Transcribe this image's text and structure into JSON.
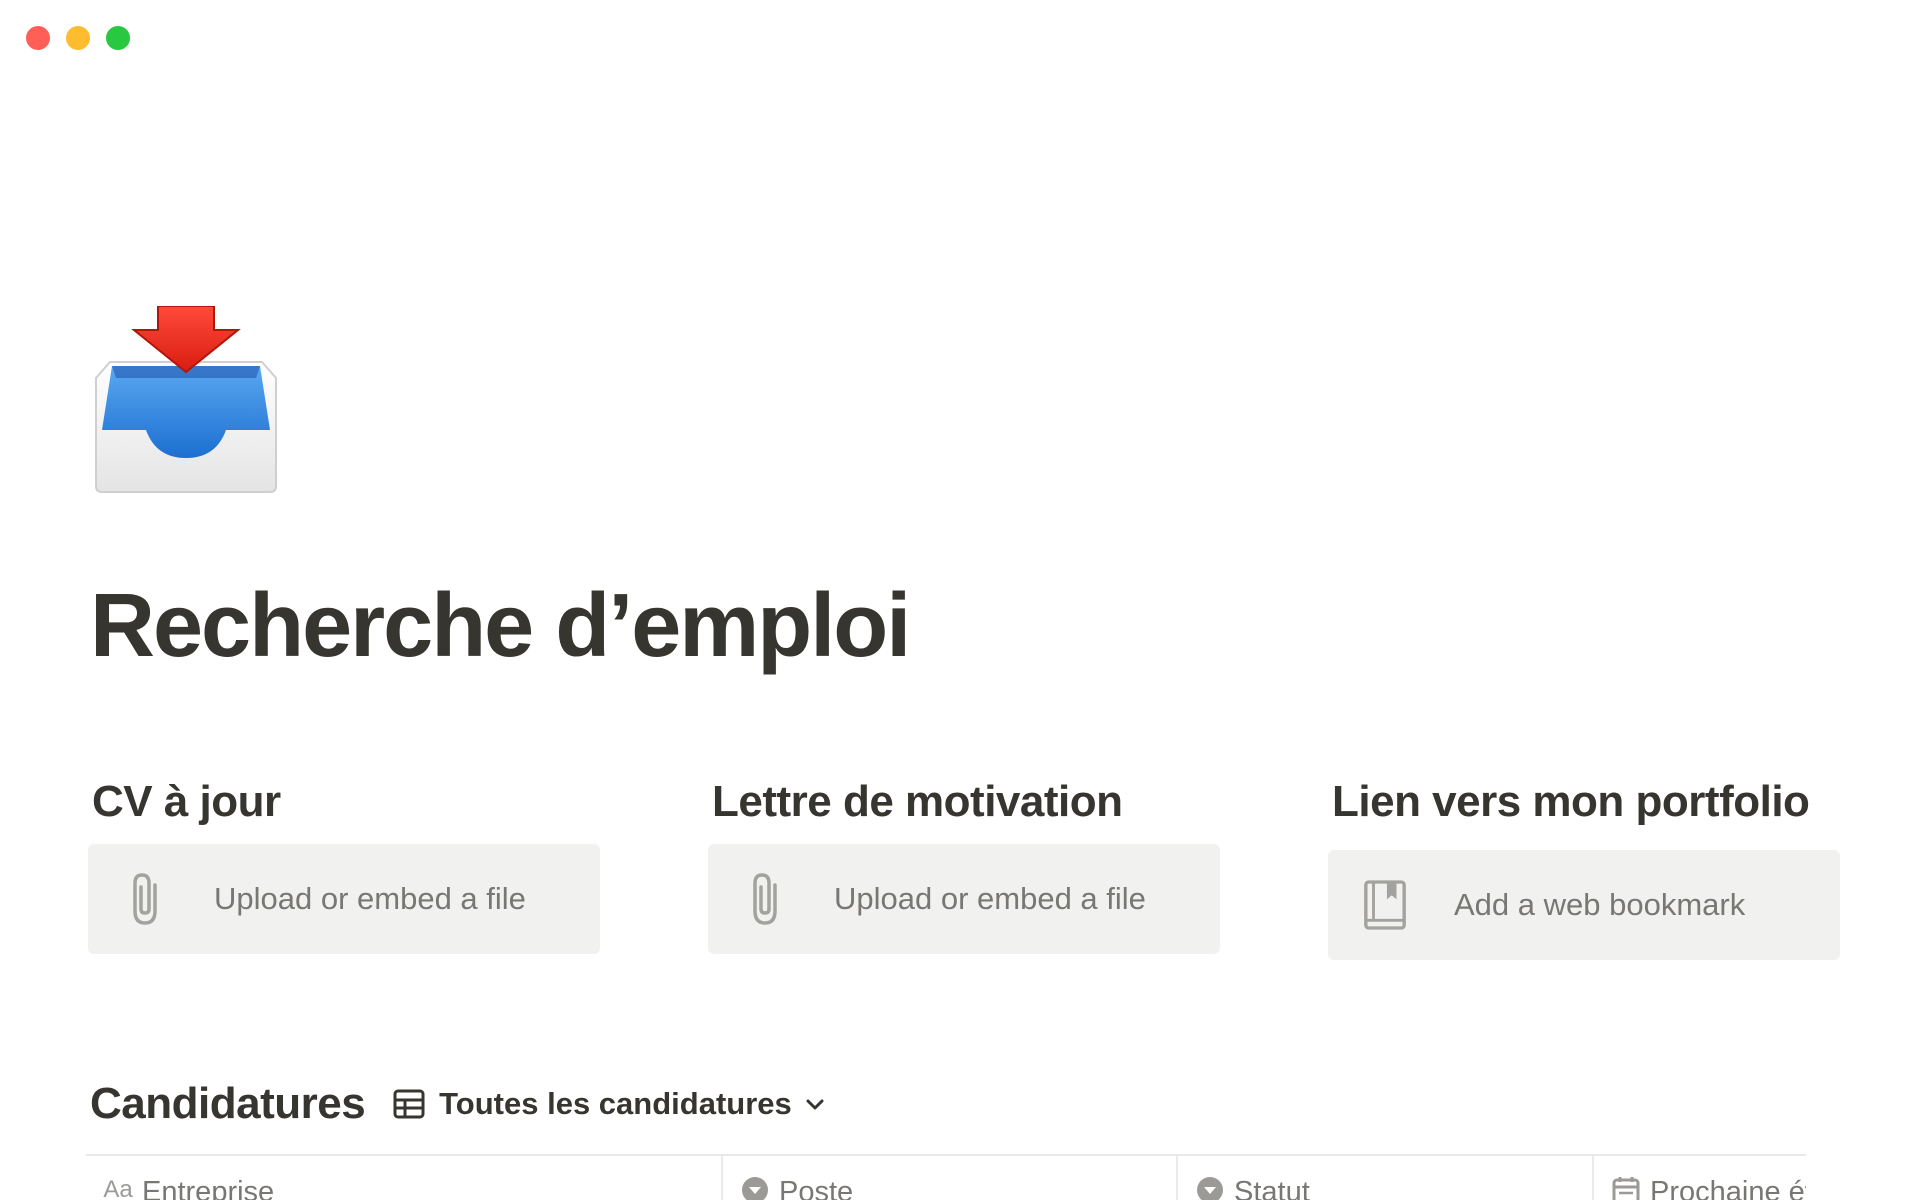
{
  "window": {
    "controls": [
      "close",
      "minimize",
      "zoom"
    ]
  },
  "page": {
    "icon": "inbox-tray-icon",
    "title": "Recherche d’emploi"
  },
  "columns": [
    {
      "heading": "CV à jour",
      "block_label": "Upload or embed a file",
      "block_icon": "paperclip-icon"
    },
    {
      "heading": "Lettre de motivation",
      "block_label": "Upload or embed a file",
      "block_icon": "paperclip-icon"
    },
    {
      "heading": "Lien vers mon portfolio",
      "block_label": "Add a web bookmark",
      "block_icon": "bookmark-book-icon"
    }
  ],
  "database": {
    "title": "Candidatures",
    "view_icon": "table-icon",
    "view_label": "Toutes les candidatures",
    "columns": [
      {
        "label": "Entreprise",
        "icon": "Aa"
      },
      {
        "label": "Poste",
        "icon": "select-icon"
      },
      {
        "label": "Statut",
        "icon": "select-icon"
      },
      {
        "label": "Prochaine étape",
        "icon": "calendar-icon"
      }
    ]
  },
  "colors": {
    "text": "#37352f",
    "muted": "#787774",
    "block_bg": "#f1f1ef",
    "border": "#e9e9e7",
    "close": "#ff5f57",
    "minimize": "#febc2e",
    "zoom": "#28c840"
  }
}
